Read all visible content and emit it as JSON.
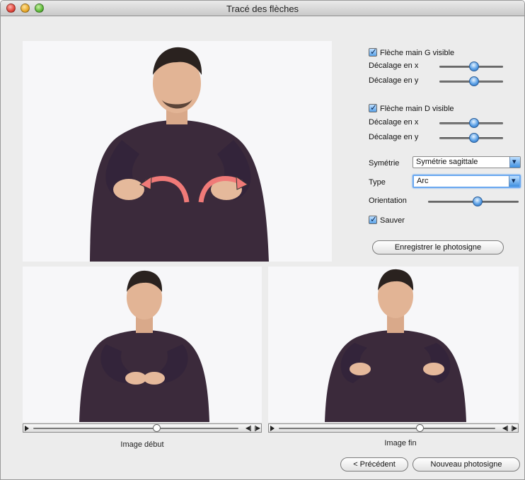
{
  "window": {
    "title": "Tracé des flèches"
  },
  "left_arrow": {
    "visible_label": "Flèche main G visible",
    "visible_checked": true,
    "offset_x_label": "Décalage en x",
    "offset_x_value": 0.55,
    "offset_y_label": "Décalage en y",
    "offset_y_value": 0.55
  },
  "right_arrow": {
    "visible_label": "Flèche main D visible",
    "visible_checked": true,
    "offset_x_label": "Décalage en x",
    "offset_x_value": 0.55,
    "offset_y_label": "Décalage en y",
    "offset_y_value": 0.55
  },
  "symmetry": {
    "label": "Symétrie",
    "selected": "Symétrie sagittale"
  },
  "type": {
    "label": "Type",
    "selected": "Arc"
  },
  "orientation": {
    "label": "Orientation",
    "value": 0.55
  },
  "save": {
    "label": "Sauver",
    "checked": true
  },
  "buttons": {
    "save_photosign": "Enregistrer le photosigne",
    "previous": "< Précédent",
    "new_photosign": "Nouveau photosigne"
  },
  "start_frame": {
    "caption": "Image début",
    "position": 0.6
  },
  "end_frame": {
    "caption": "Image fin",
    "position": 0.65
  },
  "colors": {
    "arrow": "#f07a78",
    "shirt": "#3a2a3a",
    "accent": "#5aa0e6"
  }
}
